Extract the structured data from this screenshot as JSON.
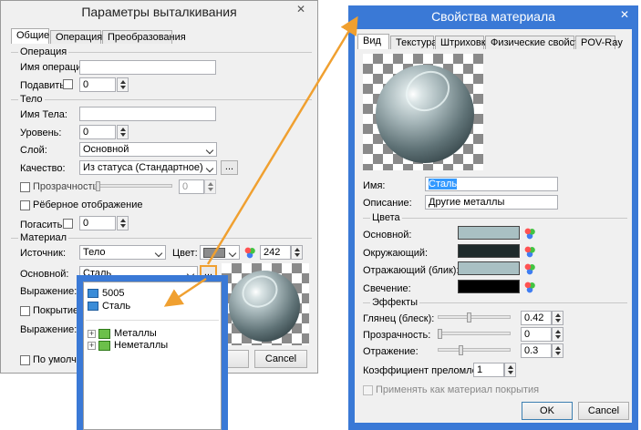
{
  "left_dialog": {
    "title": "Параметры выталкивания",
    "tabs": [
      "Общие",
      "Операция",
      "Преобразования"
    ],
    "sections": {
      "operation": "Операция",
      "body": "Тело",
      "material": "Материал"
    },
    "fields": {
      "operation_name_label": "Имя операции:",
      "suppress_label": "Подавить:",
      "suppress_value": "0",
      "body_name_label": "Имя Тела:",
      "level_label": "Уровень:",
      "level_value": "0",
      "layer_label": "Слой:",
      "layer_value": "Основной",
      "quality_label": "Качество:",
      "quality_value": "Из статуса (Стандартное)",
      "transparency_label": "Прозрачность:",
      "transparency_value": "0",
      "wireframe_label": "Рёберное отображение",
      "hide_label": "Погасить:",
      "hide_value": "0",
      "source_label": "Источник:",
      "source_value": "Тело",
      "color_label": "Цвет:",
      "color_value": "242",
      "main_label": "Основной:",
      "main_value": "Сталь",
      "expression_label": "Выражение:",
      "coating_label": "Покрытие:",
      "expression2_label": "Выражение:",
      "default_label": "По умолчанию"
    },
    "dots_label": "...",
    "close_glyph": "✕",
    "cancel_label": "Cancel",
    "color_swatch": "#8c8c8c"
  },
  "dropdown": {
    "items": [
      {
        "label": "5005",
        "kind": "material"
      },
      {
        "label": "Сталь",
        "kind": "material"
      },
      {
        "label": "Металлы",
        "kind": "group"
      },
      {
        "label": "Неметаллы",
        "kind": "group"
      }
    ]
  },
  "right_dialog": {
    "title": "Свойства материала",
    "close_glyph": "✕",
    "tabs": [
      "Вид",
      "Текстура",
      "Штриховка",
      "Физические свойства",
      "POV-Ray"
    ],
    "name_label": "Имя:",
    "name_value": "Сталь",
    "description_label": "Описание:",
    "description_value": "Другие металлы",
    "colors_section": "Цвета",
    "colors": [
      {
        "label": "Основной:",
        "swatch": "#a9c0c3"
      },
      {
        "label": "Окружающий:",
        "swatch": "#1e2a2b"
      },
      {
        "label": "Отражающий (блик):",
        "swatch": "#a9c0c3"
      },
      {
        "label": "Свечение:",
        "swatch": "#000000"
      }
    ],
    "effects_section": "Эффекты",
    "effects": [
      {
        "label": "Глянец (блеск):",
        "value": "0.42",
        "level": 0.42
      },
      {
        "label": "Прозрачность:",
        "value": "0",
        "level": 0
      },
      {
        "label": "Отражение:",
        "value": "0.3",
        "level": 0.3
      }
    ],
    "refraction_label": "Коэффициент преломления:",
    "refraction_value": "1",
    "apply_coating_label": "Применять как материал покрытия",
    "ok_label": "OK",
    "cancel_label": "Cancel"
  },
  "colors": {
    "accent_blue": "#3a79d6",
    "arrow_orange": "#f0a030",
    "selection": "#3399ff"
  }
}
